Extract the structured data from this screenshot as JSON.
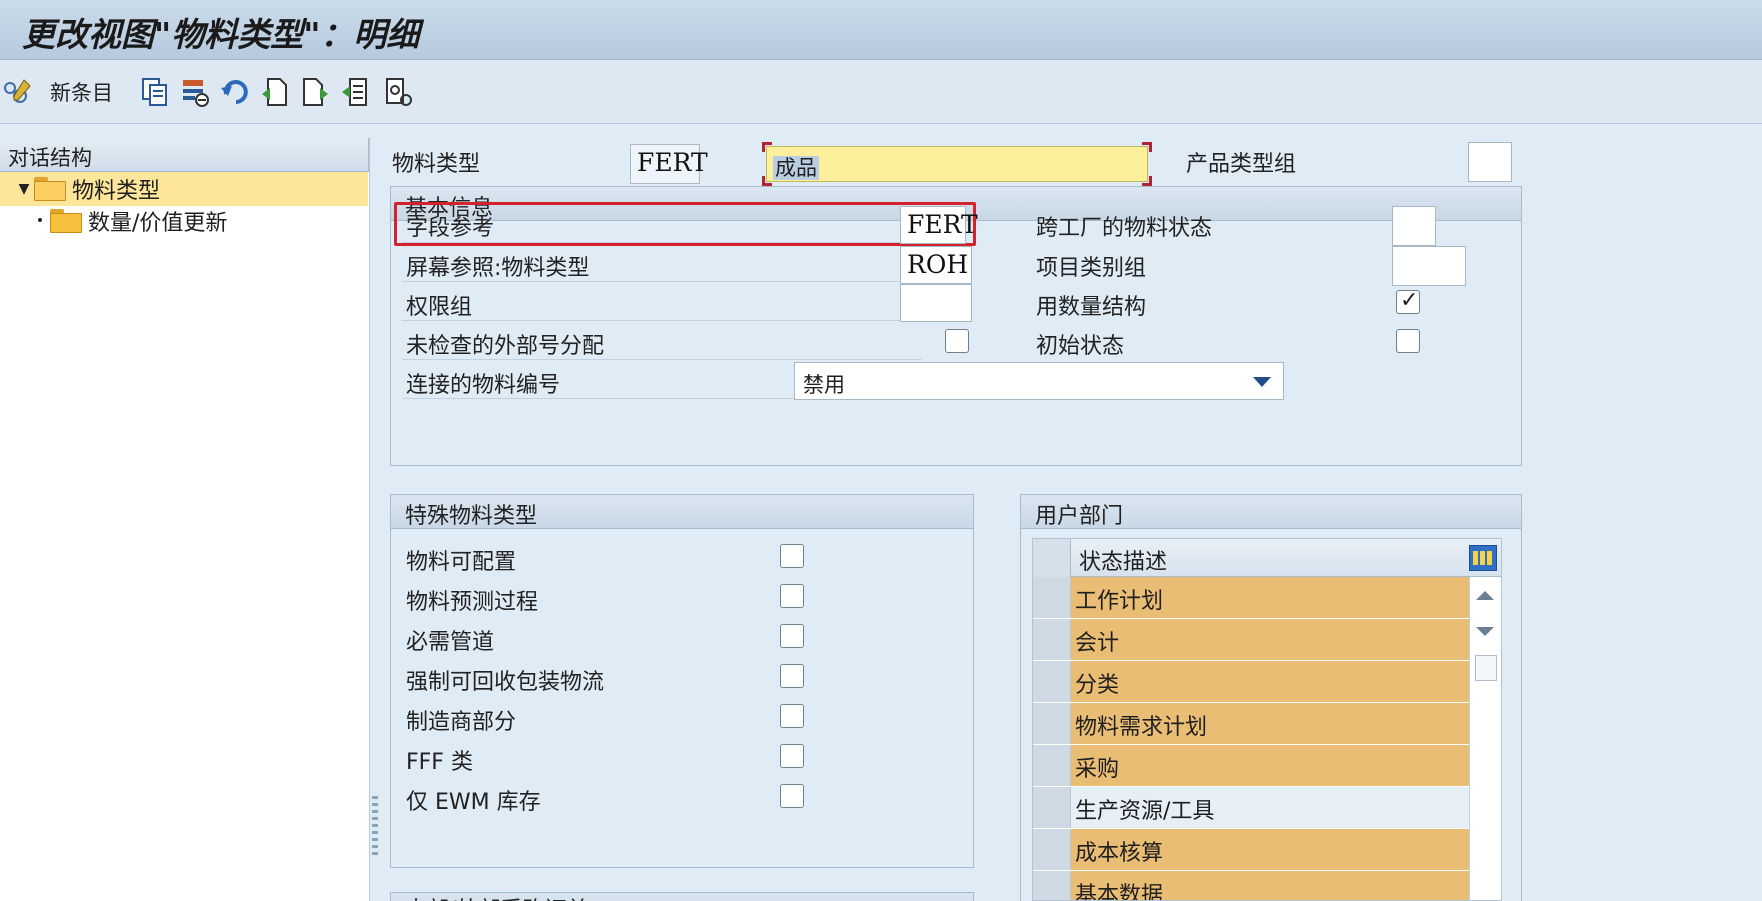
{
  "window": {
    "title": "更改视图\"物料类型\"：明细"
  },
  "toolbar": {
    "new_entries_label": "新条目"
  },
  "tree": {
    "header": "对话结构",
    "items": [
      {
        "label": "物料类型",
        "selected": true,
        "expanded": true
      },
      {
        "label": "数量/价值更新",
        "selected": false
      }
    ]
  },
  "header_fields": {
    "material_type_label": "物料类型",
    "material_type_value": "FERT",
    "material_type_desc": "成品",
    "product_type_group_label": "产品类型组",
    "product_type_group_value": ""
  },
  "basic_info": {
    "title": "基本信息",
    "field_reference_label": "字段参考",
    "field_reference_value": "FERT",
    "screen_reference_label": "屏幕参照:物料类型",
    "screen_reference_value": "ROH",
    "auth_group_label": "权限组",
    "auth_group_value": "",
    "unchecked_ext_no_label": "未检查的外部号分配",
    "unchecked_ext_no_checked": false,
    "linked_material_no_label": "连接的物料编号",
    "linked_material_no_value": "禁用",
    "cross_plant_status_label": "跨工厂的物料状态",
    "cross_plant_status_value": "",
    "item_category_group_label": "项目类别组",
    "item_category_group_value": "",
    "with_qty_structure_label": "用数量结构",
    "with_qty_structure_checked": true,
    "initial_status_label": "初始状态",
    "initial_status_checked": false
  },
  "special_types": {
    "title": "特殊物料类型",
    "items": [
      {
        "label": "物料可配置",
        "checked": false
      },
      {
        "label": "物料预测过程",
        "checked": false
      },
      {
        "label": "必需管道",
        "checked": false
      },
      {
        "label": "强制可回收包装物流",
        "checked": false
      },
      {
        "label": "制造商部分",
        "checked": false
      },
      {
        "label": "FFF 类",
        "checked": false
      },
      {
        "label": "仅 EWM 库存",
        "checked": false
      }
    ]
  },
  "next_group": {
    "title": "内部/外部采购订单"
  },
  "user_departments": {
    "title": "用户部门",
    "column_header": "状态描述",
    "rows": [
      {
        "label": "工作计划",
        "selected": true
      },
      {
        "label": "会计",
        "selected": true
      },
      {
        "label": "分类",
        "selected": true
      },
      {
        "label": "物料需求计划",
        "selected": true
      },
      {
        "label": "采购",
        "selected": true
      },
      {
        "label": "生产资源/工具",
        "selected": false
      },
      {
        "label": "成本核算",
        "selected": true
      },
      {
        "label": "基本数据",
        "selected": true
      }
    ]
  },
  "colors": {
    "highlight_row": "#e9bd74",
    "selected_tree": "#fde59a",
    "focus_frame": "#d3212d",
    "input_highlight": "#fdf09c"
  }
}
